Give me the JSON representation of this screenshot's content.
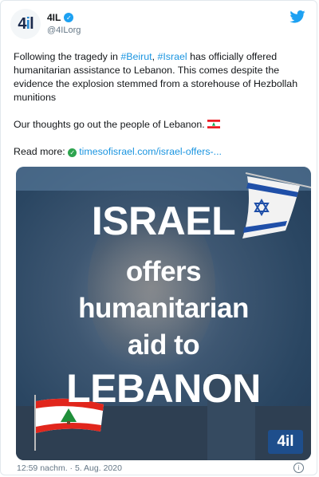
{
  "tweet": {
    "avatar_text": "4",
    "avatar_text2": "i",
    "avatar_text3": "l",
    "display_name": "4IL",
    "handle": "@4ILorg",
    "para1_a": "Following the tragedy in ",
    "hashtag1": "#Beirut",
    "para1_b": ", ",
    "hashtag2": "#Israel",
    "para1_c": " has officially offered humanitarian assistance to Lebanon. This comes despite the evidence the explosion stemmed from a storehouse of Hezbollah munitions",
    "para2": "Our thoughts go out the people of Lebanon.",
    "read_more_label": "Read more:",
    "link_text": "timesofisrael.com/israel-offers-...",
    "timestamp": "12:59 nachm. · 5. Aug. 2020"
  },
  "media": {
    "line1": "ISRAEL",
    "line2": "offers",
    "line3": "humanitarian",
    "line4": "aid to",
    "line5": "LEBANON",
    "badge": "4il"
  },
  "icons": {
    "verified": "verified-badge-icon",
    "bird": "twitter-bird-icon",
    "info": "info-icon"
  },
  "colors": {
    "link": "#1b95e0",
    "twitter_blue": "#1da1f2"
  }
}
